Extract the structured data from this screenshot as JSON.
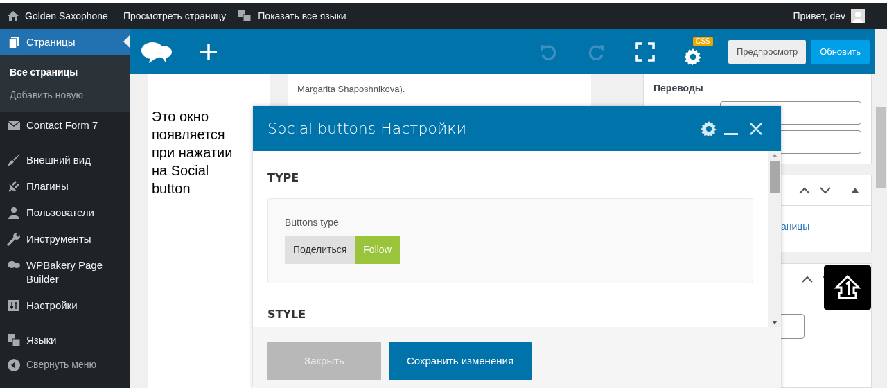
{
  "admin_bar": {
    "site": "Golden Saxophone",
    "links": [
      "Просмотреть страницу",
      "Показать все языки"
    ],
    "greeting": "Привет, dev"
  },
  "sidebar": {
    "items": [
      {
        "kind": "pages",
        "label": "Страницы",
        "selected": true,
        "children": [
          {
            "label": "Все страницы",
            "selected": true
          },
          {
            "label": "Добавить новую",
            "selected": false
          }
        ]
      },
      {
        "kind": "mail",
        "label": "Contact Form 7",
        "selected": false
      },
      {
        "kind": "brush",
        "label": "Внешний вид",
        "selected": false
      },
      {
        "kind": "plug",
        "label": "Плагины",
        "selected": false
      },
      {
        "kind": "user",
        "label": "Пользователи",
        "selected": false
      },
      {
        "kind": "wrench",
        "label": "Инструменты",
        "selected": false
      },
      {
        "kind": "cloud",
        "label": "WPBakery Page Builder",
        "selected": false
      },
      {
        "kind": "settings",
        "label": "Настройки",
        "selected": false
      },
      {
        "kind": "lang",
        "label": "Языки",
        "selected": false
      }
    ],
    "collapse": "Свернуть меню"
  },
  "toolbar": {
    "css_badge": "CSS",
    "preview": "Предпросмотр",
    "update": "Обновить",
    "undo_disabled": true,
    "redo_disabled": true
  },
  "annotation": "Это окно появляется при нажатии на Social button",
  "content_text": [
    "Margarita Shaposhnikova)."
  ],
  "side_panel": {
    "heading": "Переводы",
    "link": "аницы"
  },
  "modal": {
    "title": "Social buttons Настройки",
    "sections": [
      {
        "heading": "TYPE",
        "field": {
          "label": "Buttons type",
          "options": [
            {
              "label": "Поделиться",
              "selected": false
            },
            {
              "label": "Follow",
              "selected": true
            }
          ]
        }
      },
      {
        "heading": "STYLE"
      }
    ],
    "buttons": [
      {
        "label": "Закрыть",
        "kind": "secondary"
      },
      {
        "label": "Сохранить изменения",
        "kind": "primary"
      }
    ]
  }
}
